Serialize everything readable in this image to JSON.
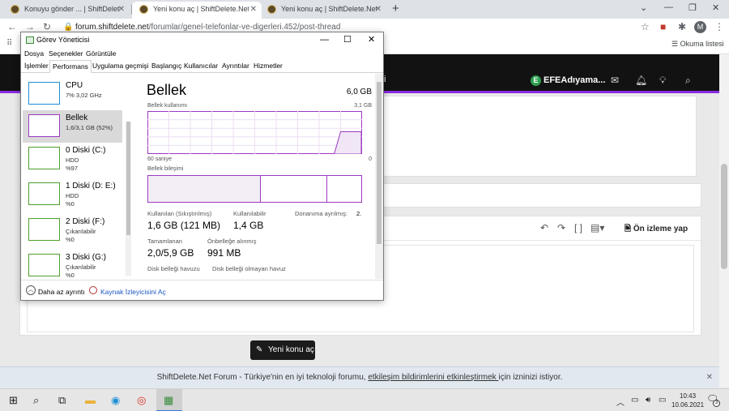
{
  "browser": {
    "tabs": [
      {
        "label": "Konuyu gönder ... | ShiftDelete.Ne"
      },
      {
        "label": "Yeni konu aç | ShiftDelete.Net Fo"
      },
      {
        "label": "Yeni konu aç | ShiftDelete.Net Fo"
      }
    ],
    "url_host": "forum.shiftdelete.net",
    "url_path": "/forumlar/genel-telefonlar-ve-digerleri.452/post-thread",
    "profile_initial": "M",
    "reading_list": "Okuma listesi"
  },
  "forum": {
    "username": "EFEAdıyama...",
    "user_initial": "E",
    "preview_label": "Ön izleme yap",
    "new_thread_label": "Yeni konu aç",
    "notification_prefix": "ShiftDelete.Net Forum - Türkiye'nin en iyi teknoloji forumu, ",
    "notification_link": "etkileşim bildirimlerini etkinleştirmek ",
    "notification_suffix": "için izninizi istiyor."
  },
  "taskmgr": {
    "title": "Görev Yöneticisi",
    "menu": [
      "Dosya",
      "Seçenekler",
      "Görüntüle"
    ],
    "tabs": [
      "İşlemler",
      "Performans",
      "Uygulama geçmişi",
      "Başlangıç",
      "Kullanıcılar",
      "Ayrıntılar",
      "Hizmetler"
    ],
    "sidebar": [
      {
        "name": "CPU",
        "sub1": "7% 3,02 GHz",
        "sub2": "",
        "color": "#1b8fd6"
      },
      {
        "name": "Bellek",
        "sub1": "1,6/3,1 GB (52%)",
        "sub2": "",
        "color": "#9b3ac0"
      },
      {
        "name": "0 Diski (C:)",
        "sub1": "HDD",
        "sub2": "%97",
        "color": "#4ca02c"
      },
      {
        "name": "1 Diski (D: E:)",
        "sub1": "HDD",
        "sub2": "%0",
        "color": "#4ca02c"
      },
      {
        "name": "2 Diski (F:)",
        "sub1": "Çıkarılabilir",
        "sub2": "%0",
        "color": "#4ca02c"
      },
      {
        "name": "3 Diski (G:)",
        "sub1": "Çıkarılabilir",
        "sub2": "%0",
        "color": "#4ca02c"
      }
    ],
    "memory": {
      "title": "Bellek",
      "total": "6,0 GB",
      "usage_label": "Bellek kullanımı",
      "usage_max": "3,1 GB",
      "time_left": "60 saniye",
      "time_right": "0",
      "composition_label": "Bellek bileşimi",
      "in_use_label": "Kullanılan (Sıkıştırılmış)",
      "in_use_value": "1,6 GB (121 MB)",
      "available_label": "Kullanılabilir",
      "available_value": "1,4 GB",
      "reserved_label": "Donanıma ayrılmış:",
      "reserved_value": "2.",
      "committed_label": "Tamamlanan",
      "committed_value": "2,0/5,9 GB",
      "cached_label": "Önbelleğe alınmış",
      "cached_value": "991 MB",
      "paged_label": "Disk belleği havuzu",
      "nonpaged_label": "Disk belleği olmayan havuz",
      "usage_fraction": 0.52,
      "composition_in_use_fraction": 0.53,
      "composition_modified_fraction": 0.31
    },
    "fewer_details": "Daha az ayrıntı",
    "resource_monitor": "Kaynak İzleyicisini Aç"
  },
  "taskbar": {
    "time": "10:43",
    "date": "10.06.2021",
    "notification_count": "3"
  },
  "colors": {
    "memory_accent": "#9b3ac0",
    "forum_header": "#121212"
  }
}
